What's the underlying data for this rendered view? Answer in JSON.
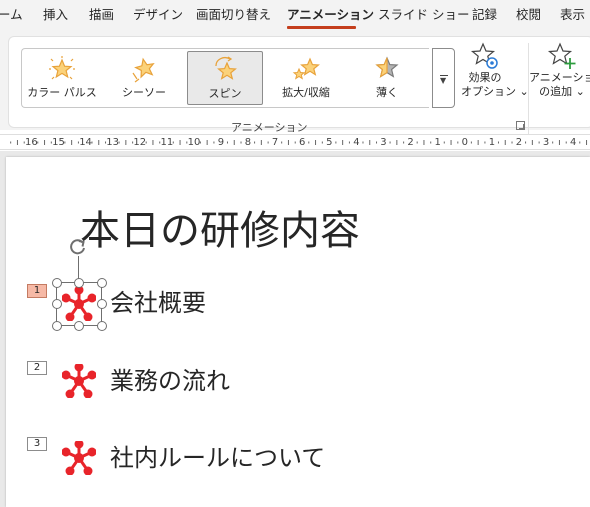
{
  "tabs": [
    {
      "label": "ーム"
    },
    {
      "label": "挿入"
    },
    {
      "label": "描画"
    },
    {
      "label": "デザイン"
    },
    {
      "label": "画面切り替え"
    },
    {
      "label": "アニメーション"
    },
    {
      "label": "スライド ショー"
    },
    {
      "label": "記録"
    },
    {
      "label": "校閲"
    },
    {
      "label": "表示"
    }
  ],
  "active_tab": "アニメーション",
  "ribbon": {
    "gallery": [
      {
        "label": "カラー パルス",
        "icon": "color-pulse-star-icon"
      },
      {
        "label": "シーソー",
        "icon": "teeter-star-icon"
      },
      {
        "label": "スピン",
        "icon": "spin-star-icon",
        "selected": true
      },
      {
        "label": "拡大/収縮",
        "icon": "grow-shrink-star-icon"
      },
      {
        "label": "薄く",
        "icon": "desaturate-star-icon"
      }
    ],
    "effect_options": {
      "line1": "効果の",
      "line2": "オプション ⌄"
    },
    "add_animation": {
      "line1": "アニメーション",
      "line2": "の追加 ⌄"
    },
    "group_label": "アニメーション"
  },
  "ruler": {
    "labels": [
      "16",
      "15",
      "14",
      "13",
      "12",
      "11",
      "10",
      "9",
      "8",
      "7",
      "6",
      "5",
      "4",
      "3",
      "2",
      "1",
      "0",
      "1",
      "2",
      "3",
      "4"
    ]
  },
  "slide": {
    "title": "本日の研修内容",
    "bullets": [
      {
        "tag": "1",
        "text": "会社概要",
        "active": true
      },
      {
        "tag": "2",
        "text": "業務の流れ",
        "active": false
      },
      {
        "tag": "3",
        "text": "社内ルールについて",
        "active": false
      }
    ]
  },
  "colors": {
    "accent": "#c43e1c",
    "star_fill": "#fbd27a",
    "star_stroke": "#e8a23a",
    "marker_red": "#e8242a",
    "tag_active": "#f6b9a6"
  }
}
